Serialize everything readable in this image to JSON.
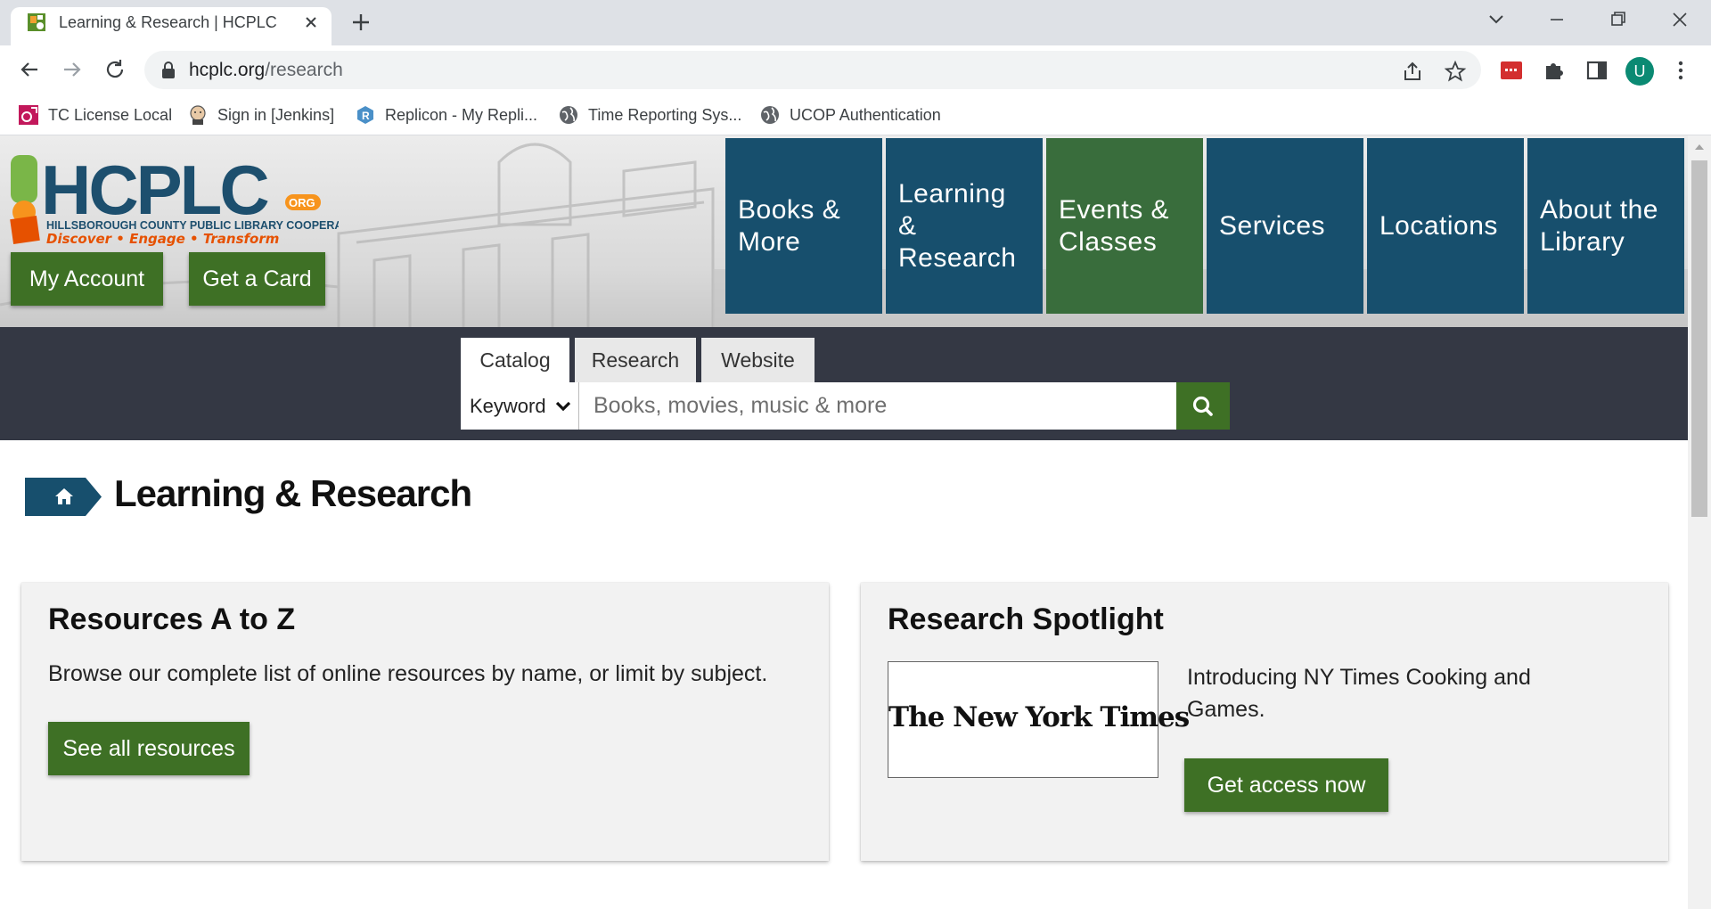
{
  "browser": {
    "tab_title": "Learning & Research | HCPLC",
    "url_domain": "hcplc.org",
    "url_path": "/research",
    "profile_initial": "U",
    "bookmarks": [
      {
        "label": "TC License Local",
        "icon": "teamcity-icon"
      },
      {
        "label": "Sign in [Jenkins]",
        "icon": "jenkins-icon"
      },
      {
        "label": "Replicon - My Repli...",
        "icon": "replicon-icon"
      },
      {
        "label": "Time Reporting Sys...",
        "icon": "globe-icon"
      },
      {
        "label": "UCOP Authentication",
        "icon": "globe-icon"
      }
    ]
  },
  "header": {
    "logo": {
      "name": "HCPLC",
      "org_badge": ".ORG",
      "full_name": "HILLSBOROUGH COUNTY PUBLIC LIBRARY COOPERATIVE",
      "tagline": [
        "Discover",
        "Engage",
        "Transform"
      ]
    },
    "my_account": "My Account",
    "get_card": "Get a Card",
    "nav": [
      {
        "line1": "Books &",
        "line2": "More"
      },
      {
        "line1": "Learning &",
        "line2": "Research"
      },
      {
        "line1": "Events &",
        "line2": "Classes"
      },
      {
        "line1": "Services",
        "line2": ""
      },
      {
        "line1": "Locations",
        "line2": ""
      },
      {
        "line1": "About the",
        "line2": "Library"
      }
    ]
  },
  "search": {
    "tabs": [
      "Catalog",
      "Research",
      "Website"
    ],
    "active_tab": "Catalog",
    "keyword_select": "Keyword",
    "placeholder": "Books, movies, music & more"
  },
  "page": {
    "title": "Learning & Research"
  },
  "cards": {
    "resources": {
      "title": "Resources A to Z",
      "description": "Browse our complete list of online resources by name, or limit by subject.",
      "button": "See all resources"
    },
    "spotlight": {
      "title": "Research Spotlight",
      "image_text": "The New York Times",
      "description": "Introducing NY Times Cooking and Games.",
      "button": "Get access now"
    }
  },
  "colors": {
    "nav_blue": "#174f6d",
    "nav_green": "#396d3c",
    "button_green": "#3e7025",
    "search_band": "#343844"
  }
}
